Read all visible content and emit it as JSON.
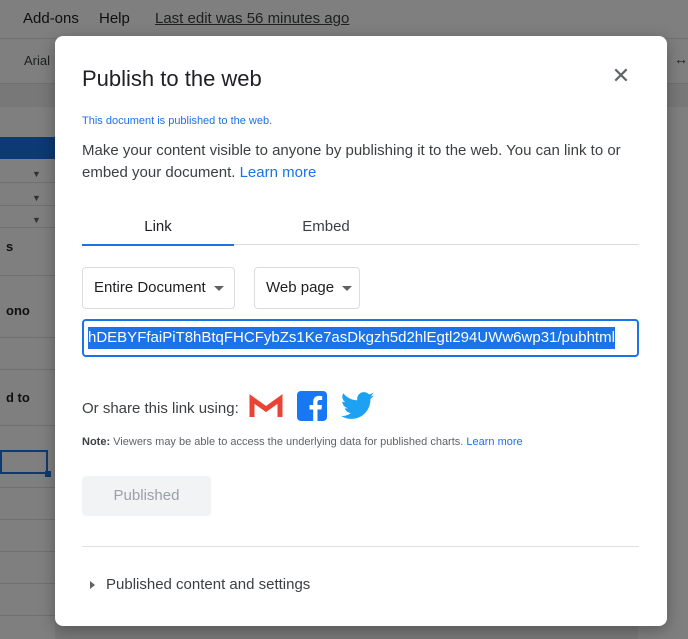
{
  "menubar": {
    "items": [
      "Add-ons",
      "Help"
    ],
    "last_edit": "Last edit was 56 minutes ago"
  },
  "toolbar": {
    "font": "Arial"
  },
  "sheet": {
    "cells": [
      "s",
      "ono",
      "d to"
    ]
  },
  "dialog": {
    "title": "Publish to the web",
    "status": "This document is published to the web.",
    "description": "Make your content visible to anyone by publishing it to the web. You can link to or embed your document.",
    "learn_more": "Learn more",
    "tabs": [
      {
        "label": "Link",
        "active": true
      },
      {
        "label": "Embed",
        "active": false
      }
    ],
    "scope_select": "Entire Document",
    "format_select": "Web page",
    "url": "hDEBYFfaiPiT8hBtqFHCFybZs1Ke7asDkgzh5d2hlEgtl294UWw6wp31/pubhtml",
    "share_label": "Or share this link using:",
    "share_icons": [
      "gmail-icon",
      "facebook-icon",
      "twitter-icon"
    ],
    "note_label": "Note:",
    "note_text": "Viewers may be able to access the underlying data for published charts.",
    "note_link": "Learn more",
    "published_button": "Published",
    "expander": "Published content and settings"
  },
  "colors": {
    "accent": "#1a73e8",
    "gmail": "#ea4335",
    "facebook": "#1877f2",
    "twitter": "#1da1f2"
  }
}
